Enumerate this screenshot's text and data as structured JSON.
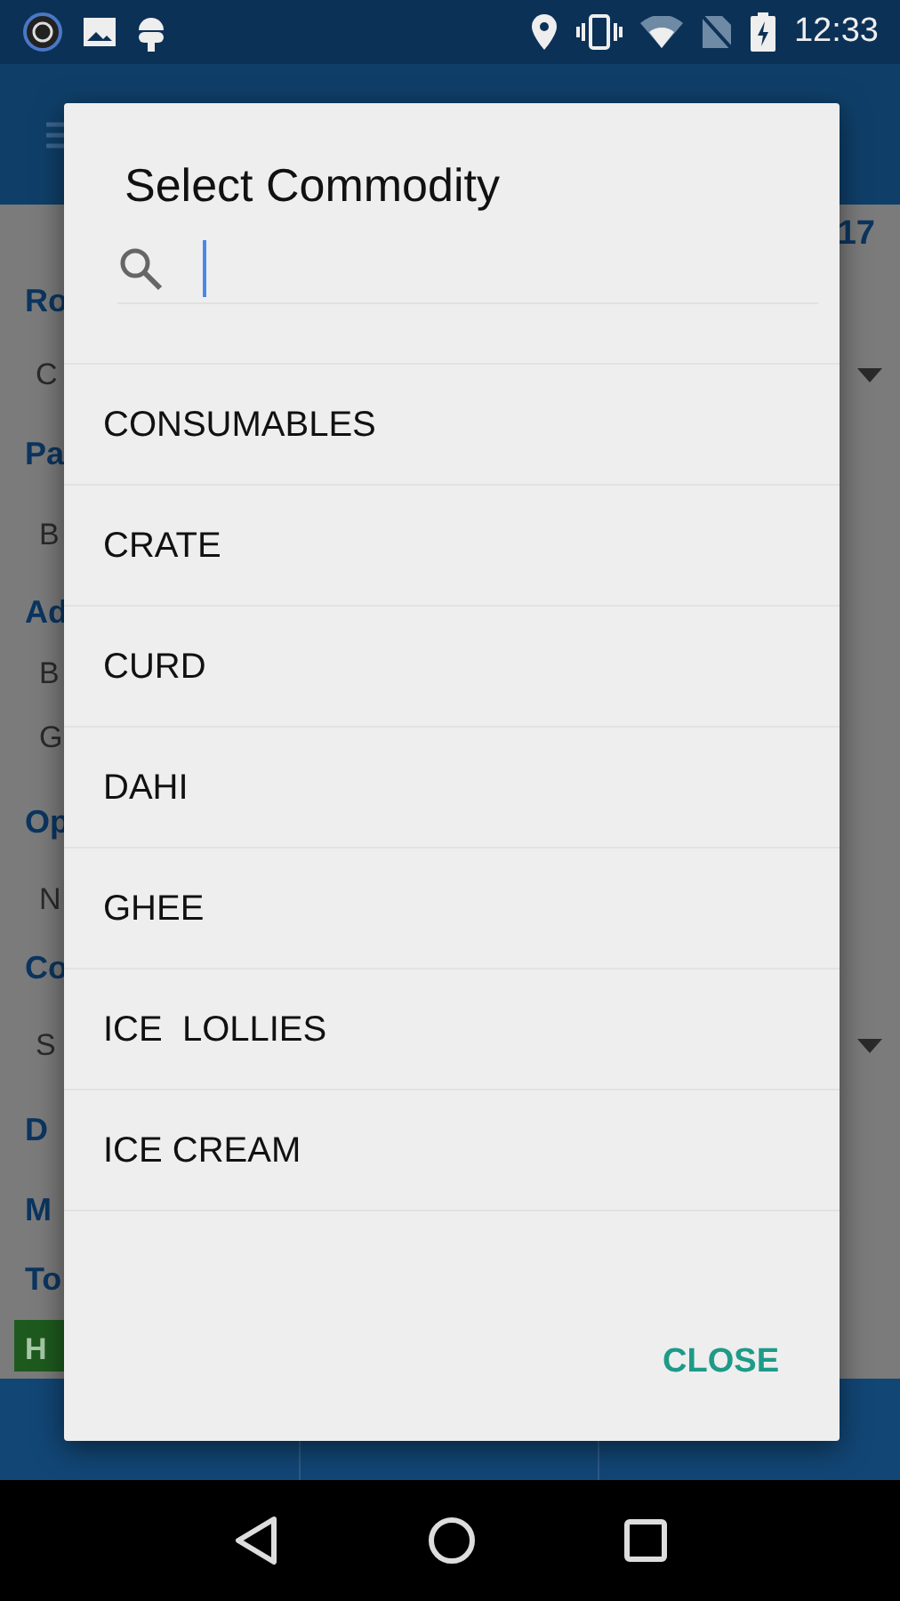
{
  "status_bar": {
    "time": "12:33"
  },
  "background": {
    "rows": [
      {
        "kind": "corner",
        "text": "17"
      },
      {
        "kind": "label",
        "text": "Ro"
      },
      {
        "kind": "dropdown",
        "text": "C"
      },
      {
        "kind": "label",
        "text": "Pa"
      },
      {
        "kind": "value",
        "text": "B"
      },
      {
        "kind": "label",
        "text": "Ad"
      },
      {
        "kind": "value",
        "text": "B"
      },
      {
        "kind": "value",
        "text": "G"
      },
      {
        "kind": "label",
        "text": "Op"
      },
      {
        "kind": "value",
        "text": "N"
      },
      {
        "kind": "label",
        "text": "Co"
      },
      {
        "kind": "dropdown",
        "text": "S"
      },
      {
        "kind": "label",
        "text": "D"
      },
      {
        "kind": "label",
        "text": "M"
      },
      {
        "kind": "label",
        "text": "To"
      },
      {
        "kind": "badge",
        "text": "H"
      }
    ]
  },
  "dialog": {
    "title": "Select Commodity",
    "search_field": {
      "focused": true
    },
    "items": [
      "CONSUMABLES",
      "CRATE",
      "CURD",
      "DAHI",
      "GHEE",
      "ICE  LOLLIES",
      "ICE CREAM"
    ],
    "close_button": "CLOSE"
  }
}
